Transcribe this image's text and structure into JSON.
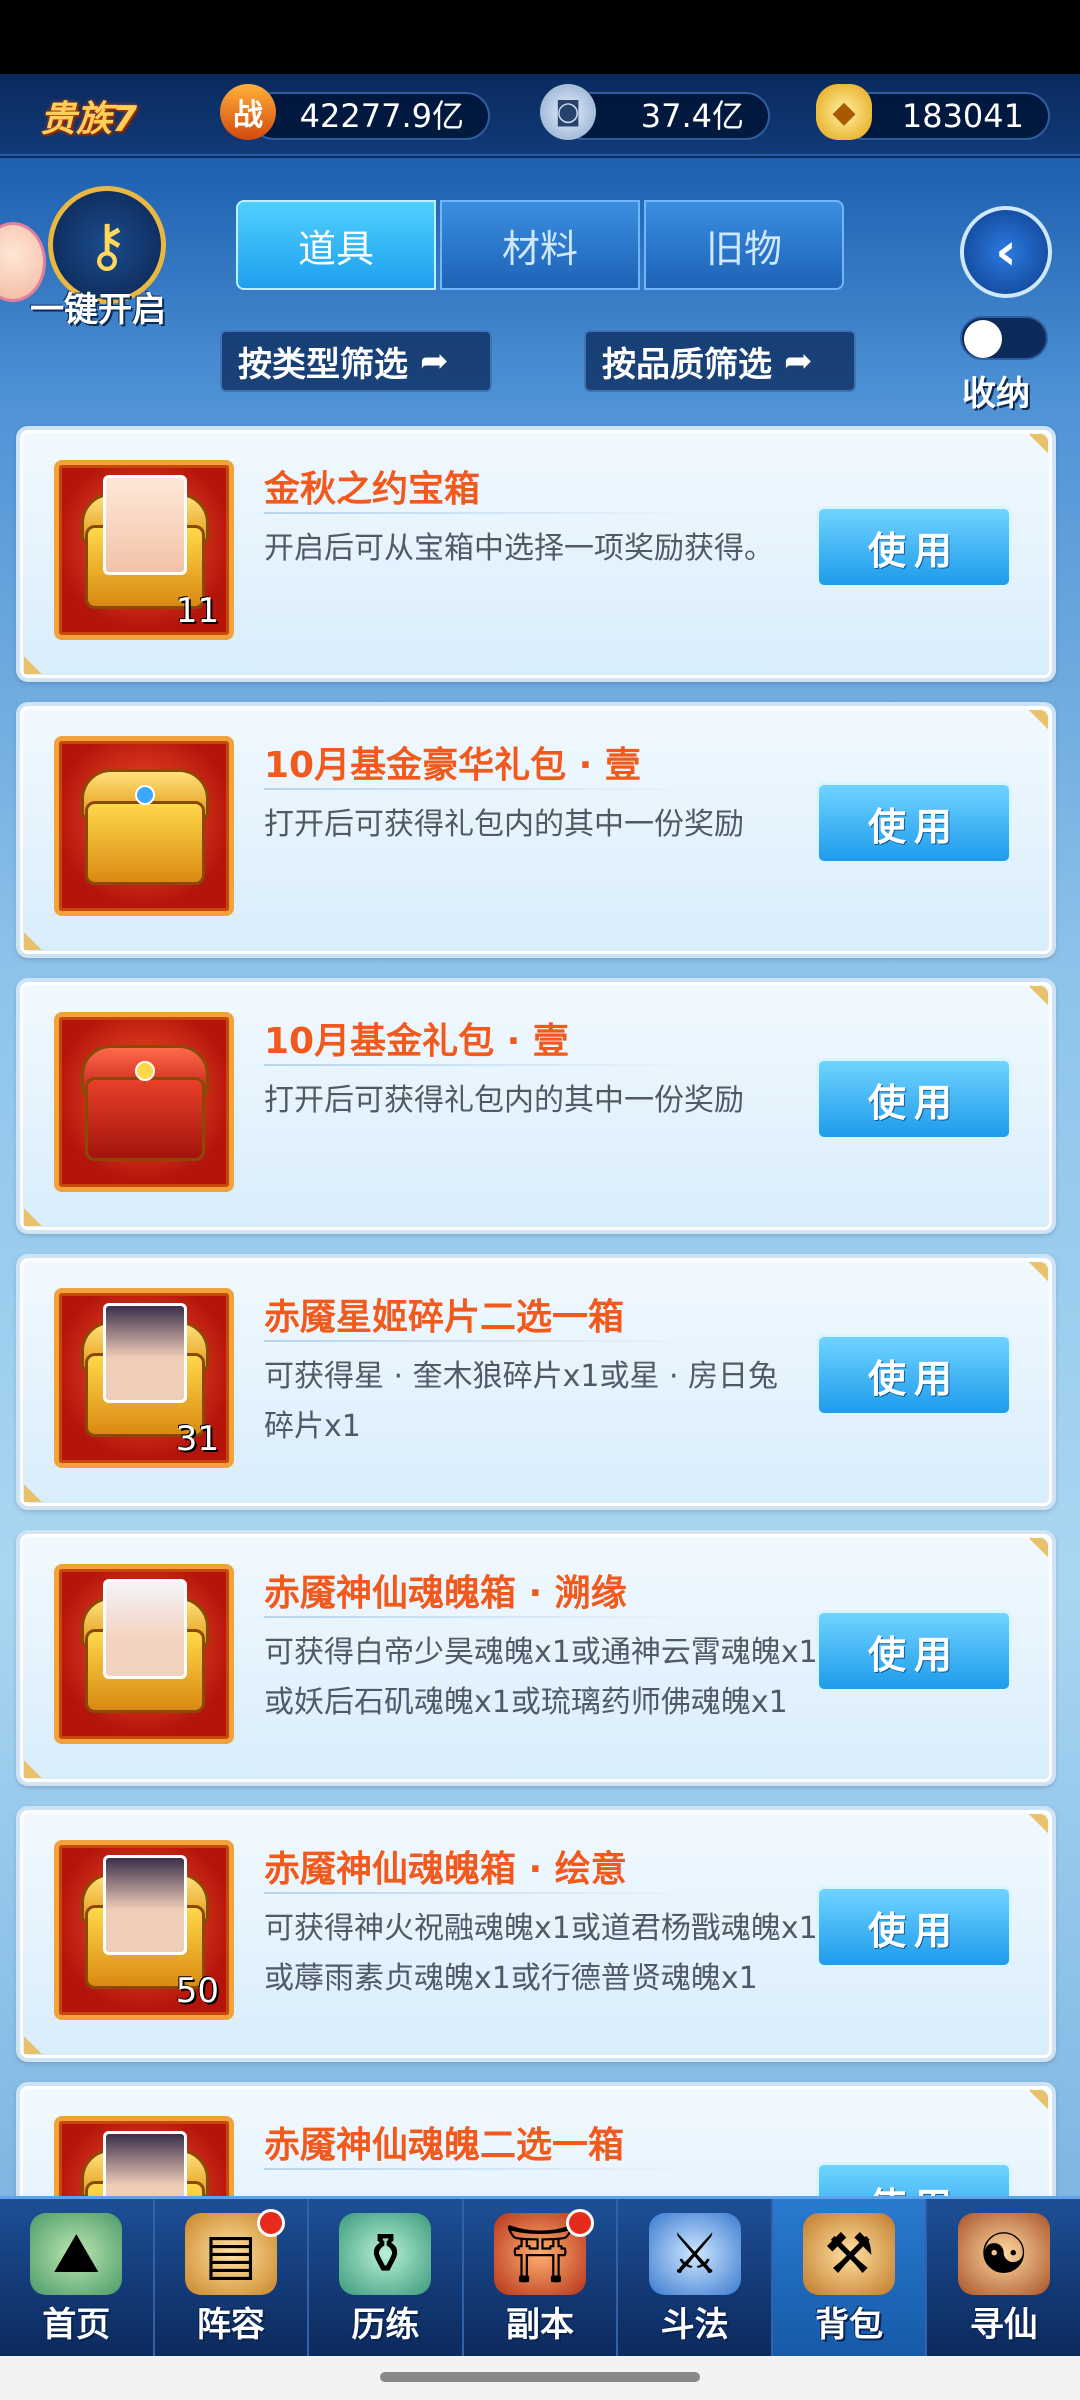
{
  "top_bar": {
    "rank": "贵族7",
    "power_label": "战",
    "power_value": "42277.9亿",
    "coins_value": "37.4亿",
    "gold_value": "183041"
  },
  "controls": {
    "one_key_open": "一键开启",
    "tabs": [
      {
        "label": "道具",
        "active": true
      },
      {
        "label": "材料",
        "active": false
      },
      {
        "label": "旧物",
        "active": false
      }
    ],
    "filter_type": "按类型筛选",
    "filter_quality": "按品质筛选",
    "collect_label": "收纳"
  },
  "items": [
    {
      "name": "金秋之约宝箱",
      "desc": "开启后可从宝箱中选择一项奖励获得。",
      "count": "11",
      "use": "使用"
    },
    {
      "name": "10月基金豪华礼包 · 壹",
      "desc": "打开后可获得礼包内的其中一份奖励",
      "count": "",
      "use": "使用"
    },
    {
      "name": "10月基金礼包 · 壹",
      "desc": "打开后可获得礼包内的其中一份奖励",
      "count": "",
      "use": "使用"
    },
    {
      "name": "赤魇星姬碎片二选一箱",
      "desc": "可获得星 · 奎木狼碎片x1或星 · 房日兔碎片x1",
      "count": "31",
      "use": "使用"
    },
    {
      "name": "赤魇神仙魂魄箱 · 溯缘",
      "desc": "可获得白帝少昊魂魄x1或通神云霄魂魄x1或妖后石矶魂魄x1或琉璃药师佛魂魄x1",
      "count": "",
      "use": "使用"
    },
    {
      "name": "赤魇神仙魂魄箱 · 绘意",
      "desc": "可获得神火祝融魂魄x1或道君杨戬魂魄x1或蓐雨素贞魂魄x1或行德普贤魂魄x1",
      "count": "50",
      "use": "使用"
    },
    {
      "name": "赤魇神仙魂魄二选一箱",
      "desc": "",
      "count": "",
      "use": "使用"
    }
  ],
  "nav": [
    {
      "label": "首页",
      "icon": "home-icon",
      "dot": false,
      "active": false
    },
    {
      "label": "阵容",
      "icon": "lineup-icon",
      "dot": true,
      "active": false
    },
    {
      "label": "历练",
      "icon": "training-icon",
      "dot": false,
      "active": false
    },
    {
      "label": "副本",
      "icon": "dungeon-icon",
      "dot": true,
      "active": false
    },
    {
      "label": "斗法",
      "icon": "battle-icon",
      "dot": false,
      "active": false
    },
    {
      "label": "背包",
      "icon": "bag-icon",
      "dot": false,
      "active": true
    },
    {
      "label": "寻仙",
      "icon": "seek-immortal-icon",
      "dot": false,
      "active": false
    }
  ]
}
